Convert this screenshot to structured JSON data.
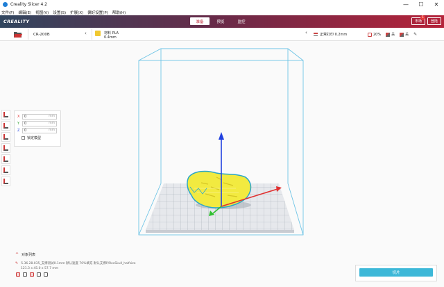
{
  "window": {
    "title": "Creality Slicer 4.2",
    "minimize": "—",
    "maximize": "☐",
    "close": "✕"
  },
  "menu": [
    "文件(F)",
    "编辑(E)",
    "视图(V)",
    "设置(S)",
    "扩展(X)",
    "偏好设置(P)",
    "帮助(H)"
  ],
  "banner": {
    "logo": "CREALITY",
    "tabs": [
      "准备",
      "预览",
      "监控"
    ],
    "active_tab": "准备",
    "btn_left": "市场",
    "btn_right": "登陆",
    "badge_count": "1"
  },
  "toolbar": {
    "printer": "CR-200B",
    "material_name": "材料 PLA",
    "material_size": "0.4mm",
    "profile": "正常打印 0.2mm",
    "infill": "20%",
    "support": "关",
    "adhesion": "关"
  },
  "move_panel": {
    "x_label": "X",
    "x_value": "0",
    "x_unit": "mm",
    "y_label": "Y",
    "y_value": "0",
    "y_unit": "mm",
    "z_label": "Z",
    "z_value": "0",
    "z_unit": "mm",
    "lock_label": "锁定模型"
  },
  "object_list": {
    "header": "对象列表",
    "file": "5.36.28.035_支撑测试0.1mm 默认速度 70%填充 默认支撑P/RexSkull_halfsize",
    "dims": "121.3 x 45.0 x 57.7 mm"
  },
  "slice": {
    "button": "切片"
  },
  "colors": {
    "accent": "#c02a3a",
    "slice_button": "#3db8d8",
    "build_volume": "#60b8dc",
    "model": "#f2ea40",
    "axis_x": "#e03030",
    "axis_y": "#30c030",
    "axis_z": "#2040e0"
  }
}
